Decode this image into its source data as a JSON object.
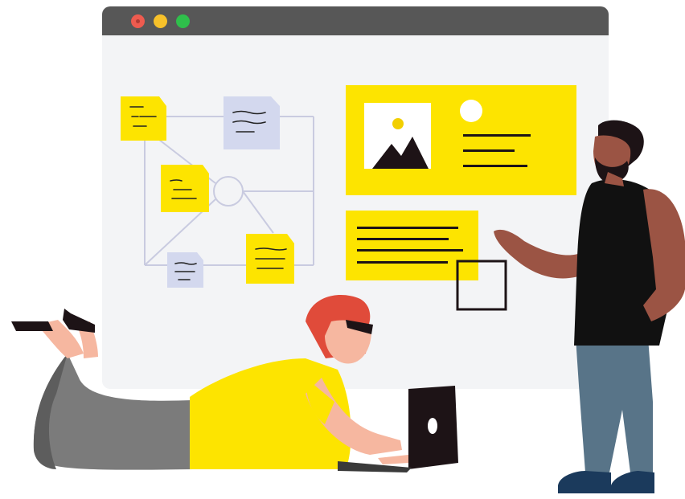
{
  "illustration": {
    "window_controls": [
      {
        "name": "close",
        "color": "#ee5b4f"
      },
      {
        "name": "minimize",
        "color": "#f7c12a"
      },
      {
        "name": "maximize",
        "color": "#2fbf4b"
      }
    ],
    "colors": {
      "accent_yellow": "#fde400",
      "sticky_blue": "#d3d8ee",
      "window_bg": "#f3f4f6",
      "titlebar": "#575757",
      "line_gray": "#c9cbe0",
      "skin_dark": "#9b5444",
      "skin_light": "#f6b7a0",
      "hair_red": "#e04b3a",
      "pants_gray": "#7b7b7b",
      "pants_blue": "#587488",
      "shoes_navy": "#1b3a5c"
    },
    "icons": [
      "image-placeholder-icon",
      "circle-avatar-icon",
      "sticky-note-icon",
      "laptop-icon"
    ]
  }
}
